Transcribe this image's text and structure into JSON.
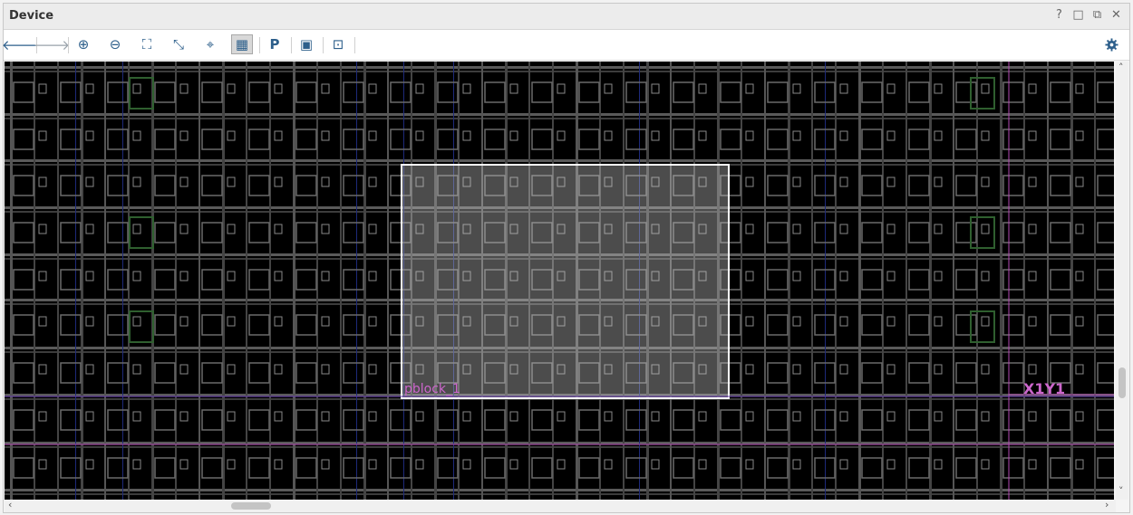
{
  "window": {
    "title": "Device",
    "controls": [
      "?",
      "□",
      "⧉",
      "✕"
    ]
  },
  "toolbar": {
    "buttons": [
      {
        "name": "back-arrow-icon",
        "glyph": "🡐",
        "enabled": true
      },
      {
        "name": "forward-arrow-icon",
        "glyph": "🡒",
        "enabled": false
      },
      {
        "name": "zoom-in-icon",
        "glyph": "⊕",
        "enabled": true
      },
      {
        "name": "zoom-out-icon",
        "glyph": "⊖",
        "enabled": true
      },
      {
        "name": "zoom-fit-icon",
        "glyph": "⛶",
        "enabled": true
      },
      {
        "name": "zoom-selection-icon",
        "glyph": "⤡",
        "enabled": true
      },
      {
        "name": "auto-fit-selection-icon",
        "glyph": "⌖",
        "enabled": true
      },
      {
        "name": "routing-resources-icon",
        "glyph": "▦",
        "enabled": true,
        "active": true
      },
      {
        "name": "draw-pblock-icon",
        "glyph": "P",
        "enabled": true
      },
      {
        "name": "hide-show-icon",
        "glyph": "▣",
        "enabled": true
      },
      {
        "name": "draw-io-bank-icon",
        "glyph": "⊡",
        "enabled": true
      }
    ],
    "settings_icon": "gear-icon"
  },
  "canvas": {
    "background": "#000000",
    "pblock_label": "pblock_1",
    "region_label": "X1Y1",
    "label_color": "#cc66cc",
    "pblock_border_color": "#ffffff"
  },
  "scrollbars": {
    "left_arrow": "‹",
    "right_arrow": "›",
    "up_arrow": "˄",
    "down_arrow": "˅"
  }
}
